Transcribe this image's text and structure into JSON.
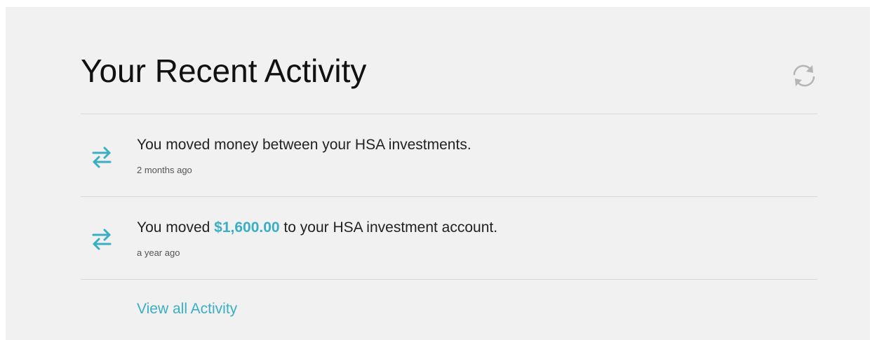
{
  "header": {
    "title": "Your Recent Activity",
    "refresh_icon": "refresh-icon"
  },
  "activity": {
    "items": [
      {
        "icon": "transfer-icon",
        "text": "You moved money between your HSA investments.",
        "time": "2 months ago"
      },
      {
        "icon": "transfer-icon",
        "text_before": "You moved ",
        "amount": "$1,600.00",
        "text_after": " to your HSA investment account.",
        "time": "a year ago"
      }
    ],
    "view_all_label": "View all Activity"
  },
  "colors": {
    "accent": "#3aaec3",
    "card_background": "#f1f1f1",
    "divider": "#d7d7d7",
    "refresh_icon": "#b5b5b5"
  }
}
